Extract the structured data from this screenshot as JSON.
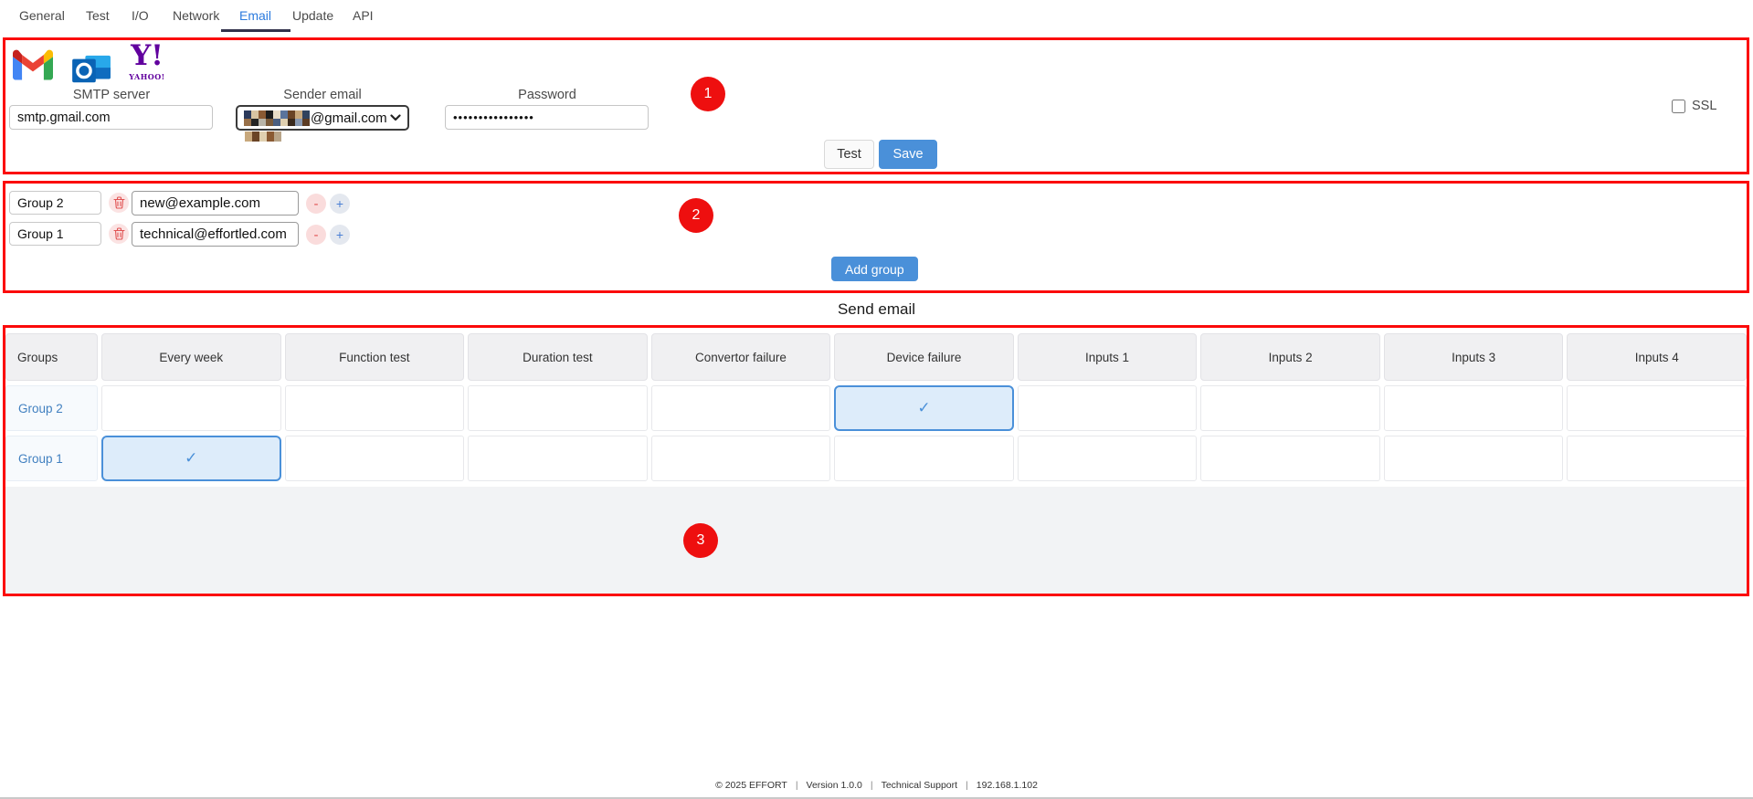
{
  "nav": {
    "tabs": [
      {
        "label": "General"
      },
      {
        "label": "Test"
      },
      {
        "label": "I/O"
      },
      {
        "label": "Network"
      },
      {
        "label": "Email",
        "active": true
      },
      {
        "label": "Update"
      },
      {
        "label": "API"
      }
    ]
  },
  "smtp": {
    "badge": "1",
    "provider_icons": [
      "gmail-icon",
      "outlook-icon",
      "yahoo-icon"
    ],
    "yahoo_text": "Y!",
    "yahoo_sub": "YAHOO!",
    "smtp_server_label": "SMTP server",
    "smtp_server_value": "smtp.gmail.com",
    "sender_label": "Sender email",
    "sender_value_visible": "@gmail.com",
    "sender_value_redacted": true,
    "password_label": "Password",
    "password_value": "••••••••••••••••",
    "ssl_label": "SSL",
    "ssl_checked": false,
    "test_button": "Test",
    "save_button": "Save"
  },
  "groups": {
    "badge": "2",
    "rows": [
      {
        "name": "Group 2",
        "email": "new@example.com"
      },
      {
        "name": "Group 1",
        "email": "technical@effortled.com"
      }
    ],
    "minus_label": "-",
    "plus_label": "+",
    "add_button": "Add group"
  },
  "send_email": {
    "badge": "3",
    "title": "Send email",
    "columns": [
      "Groups",
      "Every week",
      "Function test",
      "Duration test",
      "Convertor failure",
      "Device failure",
      "Inputs 1",
      "Inputs 2",
      "Inputs 3",
      "Inputs 4"
    ],
    "check_glyph": "✓",
    "rows": [
      {
        "group": "Group 2",
        "cells": [
          "",
          "",
          "",
          "",
          "✓",
          "",
          "",
          "",
          ""
        ]
      },
      {
        "group": "Group 1",
        "cells": [
          "✓",
          "",
          "",
          "",
          "",
          "",
          "",
          "",
          ""
        ]
      }
    ]
  },
  "footer": {
    "copyright": "© 2025 EFFORT",
    "sep": "|",
    "version": "Version 1.0.0",
    "support": "Technical Support",
    "ip": "192.168.1.102"
  },
  "colors": {
    "annotation_border": "#fb0a0a",
    "annotation_badge": "#ee0f0f",
    "accent_blue": "#4a90d9",
    "active_tab_blue": "#2a7ade",
    "checked_cell_bg": "#ddecfa",
    "danger_red": "#e05252",
    "yahoo_purple": "#61009e"
  }
}
